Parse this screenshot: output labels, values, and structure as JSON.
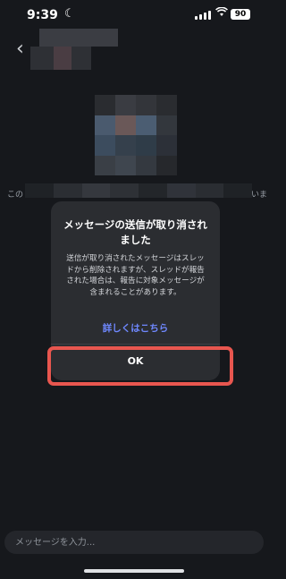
{
  "status_bar": {
    "time": "9:39",
    "battery": "90"
  },
  "chat": {
    "preview_left": "この",
    "preview_right": "いま"
  },
  "dialog": {
    "title": "メッセージの送信が取り消されました",
    "body": "送信が取り消されたメッセージはスレッドから削除されますが、スレッドが報告された場合は、報告に対象メッセージが含まれることがあります。",
    "learn_more": "詳しくはこちら",
    "ok": "OK"
  },
  "composer": {
    "placeholder": "メッセージを入力..."
  },
  "colors": {
    "highlight": "#e8564f",
    "link": "#6f88ff"
  },
  "icons": {
    "back": "chevron-left-icon",
    "moon": "moon-icon",
    "wifi": "wifi-icon"
  }
}
